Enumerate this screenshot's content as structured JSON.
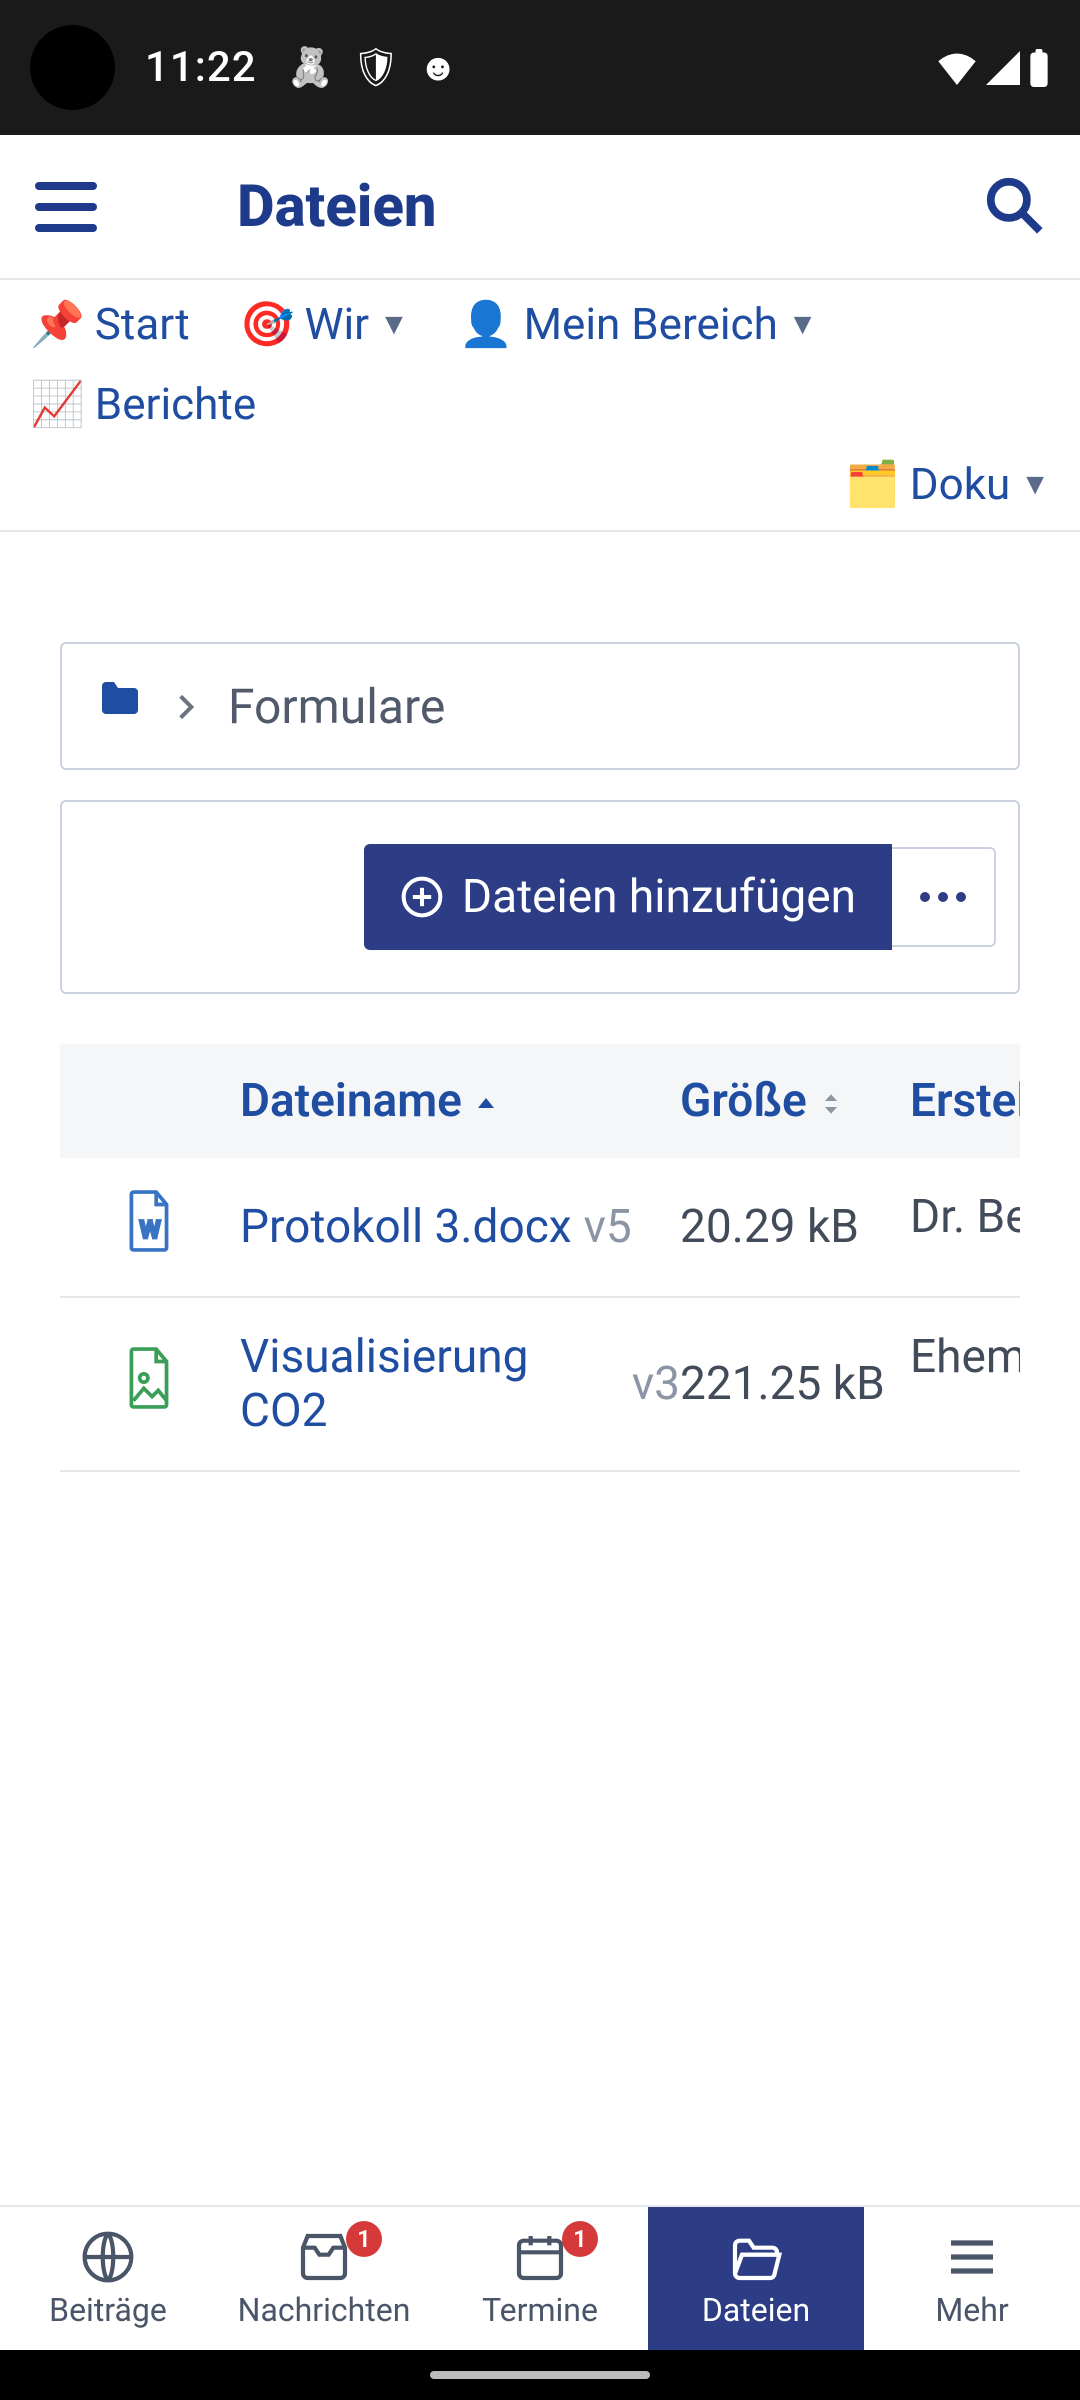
{
  "statusbar": {
    "time": "11:22"
  },
  "titlebar": {
    "title": "Dateien"
  },
  "navtabs": {
    "items": [
      {
        "emoji": "📌",
        "label": "Start",
        "dropdown": false
      },
      {
        "emoji": "🎯",
        "label": "Wir",
        "dropdown": true
      },
      {
        "emoji": "👤",
        "label": "Mein Bereich",
        "dropdown": true
      },
      {
        "emoji": "📈",
        "label": "Berichte",
        "dropdown": false
      },
      {
        "emoji": "🗂️",
        "label": "Doku",
        "dropdown": true
      }
    ]
  },
  "breadcrumb": {
    "current": "Formulare"
  },
  "actions": {
    "add_files_label": "Dateien hinzufügen"
  },
  "table": {
    "headers": {
      "name": "Dateiname",
      "size": "Größe",
      "creator": "Ersteller"
    },
    "rows": [
      {
        "type": "word",
        "name": "Protokoll 3.docx",
        "version": "v5",
        "size": "20.29 kB",
        "creator": "Dr. Bene"
      },
      {
        "type": "image",
        "name": "Visualisierung CO2",
        "version": "v3",
        "size": "221.25 kB",
        "creator": "Ehemali"
      }
    ]
  },
  "bottomnav": {
    "items": [
      {
        "key": "beitraege",
        "label": "Beiträge",
        "badge": null,
        "active": false
      },
      {
        "key": "nachrichten",
        "label": "Nachrichten",
        "badge": "1",
        "active": false
      },
      {
        "key": "termine",
        "label": "Termine",
        "badge": "1",
        "active": false
      },
      {
        "key": "dateien",
        "label": "Dateien",
        "badge": null,
        "active": true
      },
      {
        "key": "mehr",
        "label": "Mehr",
        "badge": null,
        "active": false
      }
    ]
  }
}
